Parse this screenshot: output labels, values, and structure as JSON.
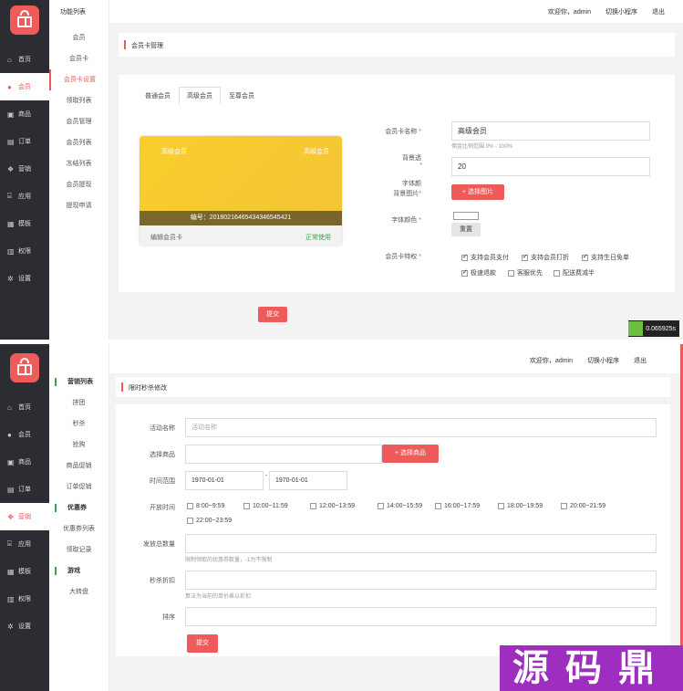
{
  "screen1": {
    "sidebar": [
      "首页",
      "会员",
      "商品",
      "订单",
      "营销",
      "应用",
      "模板",
      "权限",
      "设置"
    ],
    "sub_menu_title": "功能列表",
    "sub_menu": [
      "会员",
      "会员卡",
      "会员卡设置",
      "领取列表",
      "会员管理",
      "会员列表",
      "冻结列表",
      "会员提现",
      "提现申请"
    ],
    "topbar": {
      "welcome": "欢迎你，admin",
      "switch": "切换小程序",
      "logout": "退出"
    },
    "panel_title": "会员卡管理",
    "tabs": [
      "普通会员",
      "高级会员",
      "至尊会员"
    ],
    "card": {
      "name": "高级会员",
      "level": "高级会员",
      "number": "编号：20180216465434346545421",
      "edit": "编辑会员卡",
      "status": "正常使用"
    },
    "form": {
      "name_label": "会员卡名称",
      "name_value": "高级会员",
      "name_hint": "佣金比例范围 0% - 100%",
      "ratio_label": "背景透",
      "ratio_value": "20",
      "font_label": "字体颜",
      "bg_label": "背景图片",
      "upload": "+ 选择图片",
      "color_label": "字体颜色",
      "reset": "重置",
      "privilege_label": "会员卡特权",
      "privileges": [
        {
          "label": "支持会员支付",
          "checked": true
        },
        {
          "label": "支持会员打折",
          "checked": true
        },
        {
          "label": "支持生日免单",
          "checked": true
        },
        {
          "label": "极速退款",
          "checked": true
        },
        {
          "label": "客服优先",
          "checked": false
        },
        {
          "label": "配送费减半",
          "checked": false
        }
      ]
    },
    "submit": "提交",
    "timer": "0.065925s"
  },
  "screen2": {
    "sidebar": [
      "首页",
      "会员",
      "商品",
      "订单",
      "营销",
      "应用",
      "模板",
      "权限",
      "设置"
    ],
    "sub_menu": [
      {
        "type": "head",
        "label": "营销列表"
      },
      {
        "type": "item",
        "label": "拼团"
      },
      {
        "type": "item",
        "label": "秒杀"
      },
      {
        "type": "item",
        "label": "抢购"
      },
      {
        "type": "item",
        "label": "商品促销"
      },
      {
        "type": "item",
        "label": "订单促销"
      },
      {
        "type": "head",
        "label": "优惠券"
      },
      {
        "type": "item",
        "label": "优惠券列表"
      },
      {
        "type": "item",
        "label": "领取记录"
      },
      {
        "type": "head",
        "label": "游戏"
      },
      {
        "type": "item",
        "label": "大转盘"
      }
    ],
    "topbar": {
      "welcome": "欢迎你，admin",
      "switch": "切换小程序",
      "logout": "退出"
    },
    "panel_title": "限时秒杀修改",
    "form": {
      "name_label": "活动名称",
      "name_placeholder": "活动名称",
      "goods_label": "选择商品",
      "goods_btn": "+ 选择商品",
      "range_label": "时间范围",
      "start": "1970-01-01",
      "end": "1970-01-01",
      "time_label": "开放时间",
      "slots": [
        "8:00~9:59",
        "10:00~11:59",
        "12:00~13:59",
        "14:00~15:59",
        "16:00~17:59",
        "18:00~19:59",
        "20:00~21:59",
        "22:00~23:59"
      ],
      "total_label": "发放总数量",
      "total_hint": "限制领取的优惠券数量，-1为不限制",
      "discount_label": "秒杀折扣",
      "discount_hint": "算法为当前的单价乘以折扣",
      "sort_label": "排序"
    },
    "submit": "提交",
    "watermark": "源码鼎"
  }
}
